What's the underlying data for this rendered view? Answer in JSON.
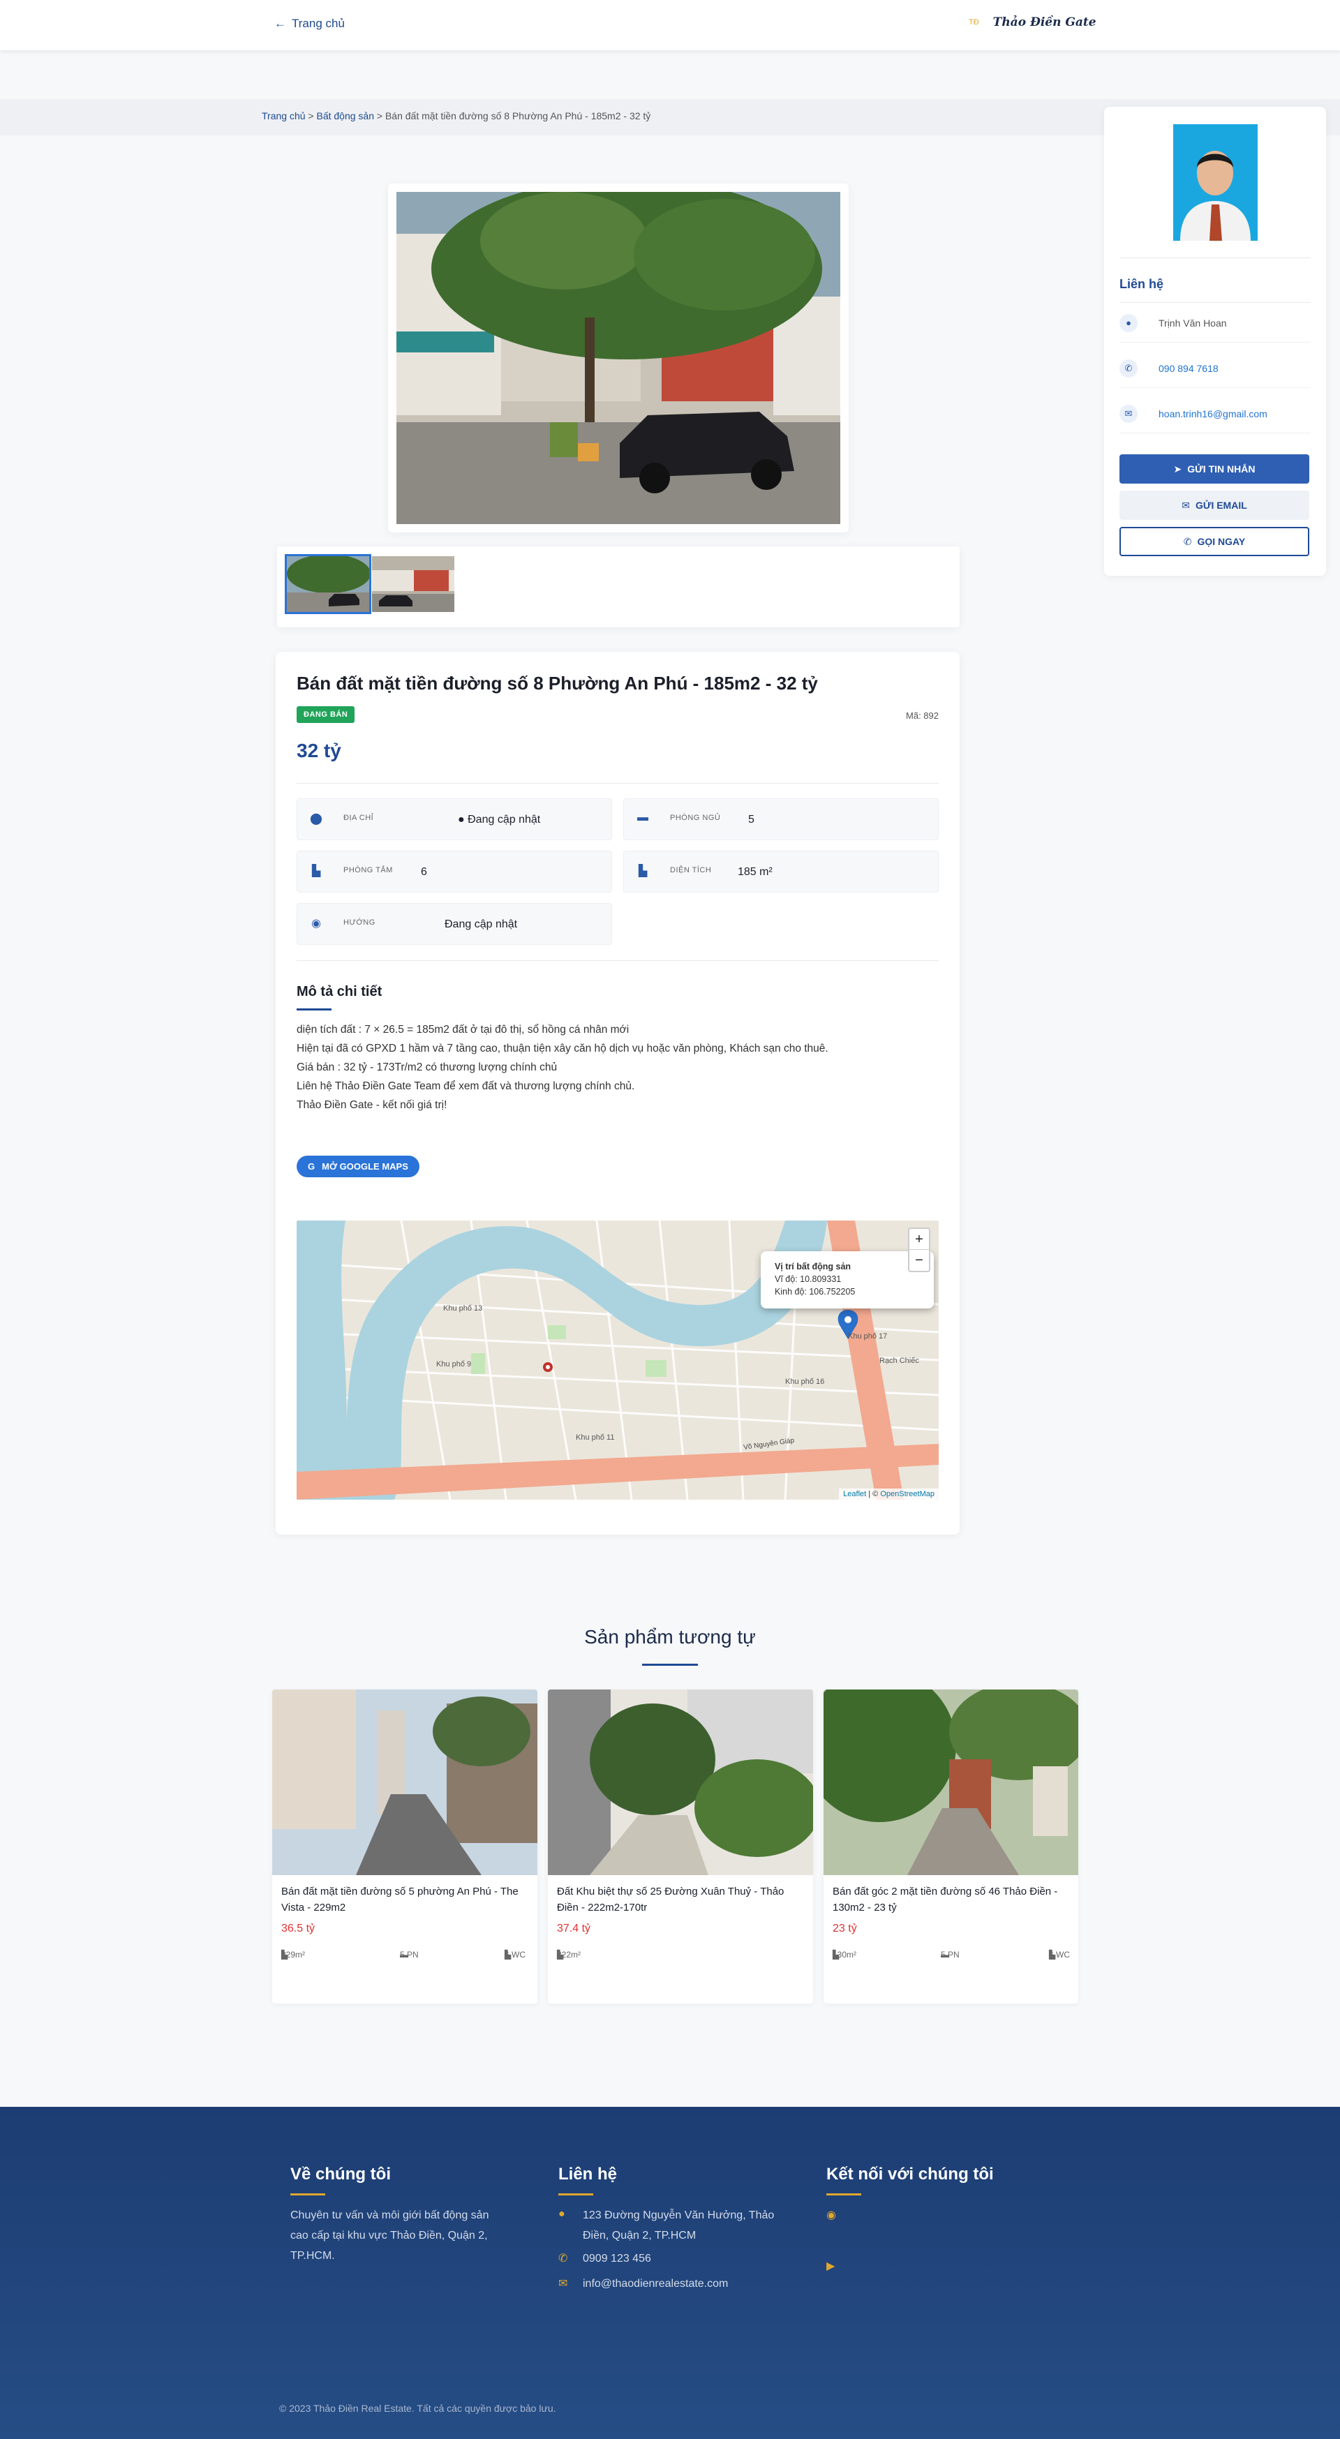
{
  "topbar": {
    "back_label": "Trang chủ",
    "logo_mark": "TĐ",
    "logo_text": "Thảo Điền Gate"
  },
  "breadcrumb": {
    "home": "Trang chủ",
    "category": "Bất động sản",
    "current": "Bán đất mặt tiền đường số 8 Phường An Phú - 185m2 - 32 tỷ",
    "sep": ">"
  },
  "listing": {
    "title": "Bán đất mặt tiền đường số 8 Phường An Phú - 185m2 - 32 tỷ",
    "status": "ĐANG BÁN",
    "code": "Mã: 892",
    "price": "32 tỷ",
    "specs": {
      "address_label": "ĐỊA CHỈ",
      "address_value": "Đang cập nhật",
      "bedrooms_label": "PHÒNG NGỦ",
      "bedrooms_value": "5",
      "bathrooms_label": "PHÒNG TẮM",
      "bathrooms_value": "6",
      "area_label": "DIỆN TÍCH",
      "area_value": "185 m²",
      "direction_label": "HƯỚNG",
      "direction_value": "Đang cập nhật"
    },
    "description_title": "Mô tả chi tiết",
    "description": [
      "diện tích đất : 7 × 26.5 = 185m2 đất ở tại đô thị, sổ hồng cá nhân mới",
      "Hiện tại đã có GPXD 1 hầm và 7 tầng cao, thuận tiện xây căn hộ dịch vụ hoặc văn phòng, Khách sạn cho thuê.",
      "Giá bán : 32 tỷ - 173Tr/m2 có thương lượng chính chủ",
      "Liên hệ Thảo Điền Gate Team để xem đất và thương lượng chính chủ.",
      "Thảo Điền Gate - kết nối giá trị!"
    ],
    "maps_button": "MỞ GOOGLE MAPS"
  },
  "map": {
    "popup_title": "Vị trí bất động sản",
    "popup_lat": "Vĩ độ: 10.809331",
    "popup_lng": "Kinh độ: 106.752205",
    "zoom_in": "+",
    "zoom_out": "−",
    "attrib_leaflet": "Leaflet",
    "attrib_sep": " | © ",
    "attrib_osm": "OpenStreetMap",
    "labels": [
      "Khu phố 13",
      "Khu phố 9",
      "Khu phố 16",
      "Khu phố 17",
      "Rạch Chiếc",
      "Võ Nguyên Giáp",
      "Khu phố 11"
    ]
  },
  "contact": {
    "heading": "Liên hệ",
    "name": "Trịnh Văn Hoan",
    "phone": "090 894 7618",
    "email": "hoan.trinh16@gmail.com",
    "btn_message": "GỬI TIN NHẮN",
    "btn_email": "GỬI EMAIL",
    "btn_call": "GỌI NGAY"
  },
  "similar": {
    "heading": "Sản phẩm tương tự",
    "items": [
      {
        "title": "Bán đất mặt tiền đường số 5 phường An Phú - The Vista - 229m2",
        "price": "36.5 tỷ",
        "area": "229m²",
        "bed": "5 PN",
        "bath": "6 WC"
      },
      {
        "title": "Đất Khu biệt thự số 25 Đường Xuân Thuỷ - Thảo Điền - 222m2-170tr",
        "price": "37.4 tỷ",
        "area": "222m²",
        "bed": "",
        "bath": ""
      },
      {
        "title": "Bán đất góc 2 mặt tiền đường số 46 Thảo Điền - 130m2 - 23 tỷ",
        "price": "23 tỷ",
        "area": "130m²",
        "bed": "5 PN",
        "bath": "6 WC"
      }
    ]
  },
  "footer": {
    "about_title": "Về chúng tôi",
    "about_text": [
      "Chuyên tư vấn và môi giới bất động sản",
      "cao cấp tại khu vực Thảo Điền, Quận 2,",
      "TP.HCM."
    ],
    "contact_title": "Liên hệ",
    "address": [
      "123 Đường Nguyễn Văn Hưởng, Thảo",
      "Điền, Quận 2, TP.HCM"
    ],
    "phone": "0909 123 456",
    "email": "info@thaodienrealestate.com",
    "social_title": "Kết nối với chúng tôi",
    "copyright": "© 2023 Thảo Điền Real Estate. Tất cả các quyền được bảo lưu."
  },
  "colors": {
    "primary": "#1f4a95",
    "accent": "#e0a82e",
    "status": "#21a45a",
    "price_red": "#e03131",
    "footer": "#1c3d73"
  }
}
